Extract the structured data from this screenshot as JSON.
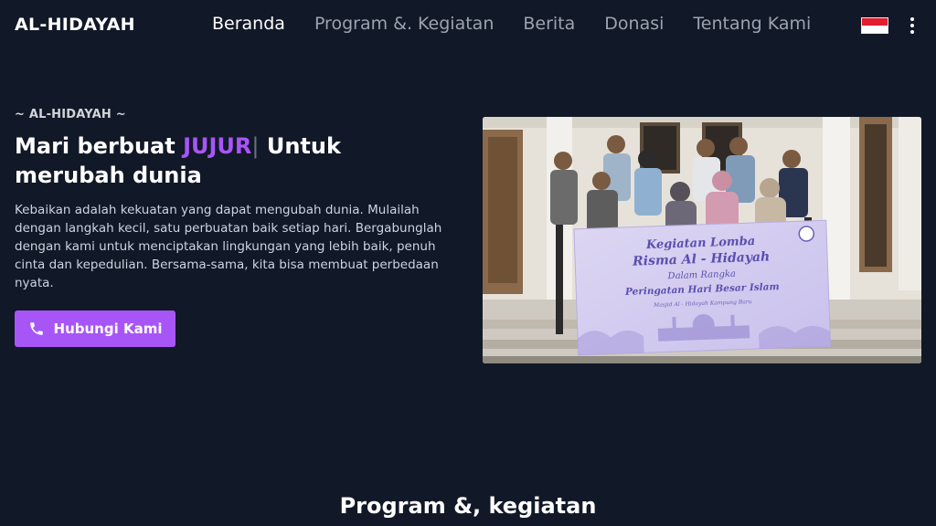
{
  "nav": {
    "brand": "AL-HIDAYAH",
    "links": [
      {
        "label": "Beranda",
        "active": true
      },
      {
        "label": "Program &. Kegiatan",
        "active": false
      },
      {
        "label": "Berita",
        "active": false
      },
      {
        "label": "Donasi",
        "active": false
      },
      {
        "label": "Tentang Kami",
        "active": false
      }
    ],
    "language_flag": "indonesia-flag-icon",
    "menu_icon": "more-vertical-icon"
  },
  "hero": {
    "eyebrow": "~ AL-HIDAYAH ~",
    "headline_before": "Mari berbuat ",
    "headline_highlight": "JUJUR",
    "headline_cursor": "|",
    "headline_after": " Untuk merubah dunia",
    "lead": "Kebaikan adalah kekuatan yang dapat mengubah dunia. Mulailah dengan langkah kecil, satu perbuatan baik setiap hari. Bergabunglah dengan kami untuk menciptakan lingkungan yang lebih baik, penuh cinta dan kepedulian. Bersama-sama, kita bisa membuat perbedaan nyata.",
    "cta_label": "Hubungi Kami",
    "cta_icon": "phone-icon",
    "banner": {
      "line1": "Kegiatan Lomba",
      "line2": "Risma Al - Hidayah",
      "line3": "Dalam Rangka",
      "line4": "Peringatan Hari Besar Islam",
      "line5": "Masjid Al - Hidayah Kampung Baru"
    }
  },
  "sections": {
    "program_title": "Program &, kegiatan"
  },
  "colors": {
    "background": "#111827",
    "accent": "#a855f7",
    "muted_text": "#9ca3af"
  }
}
